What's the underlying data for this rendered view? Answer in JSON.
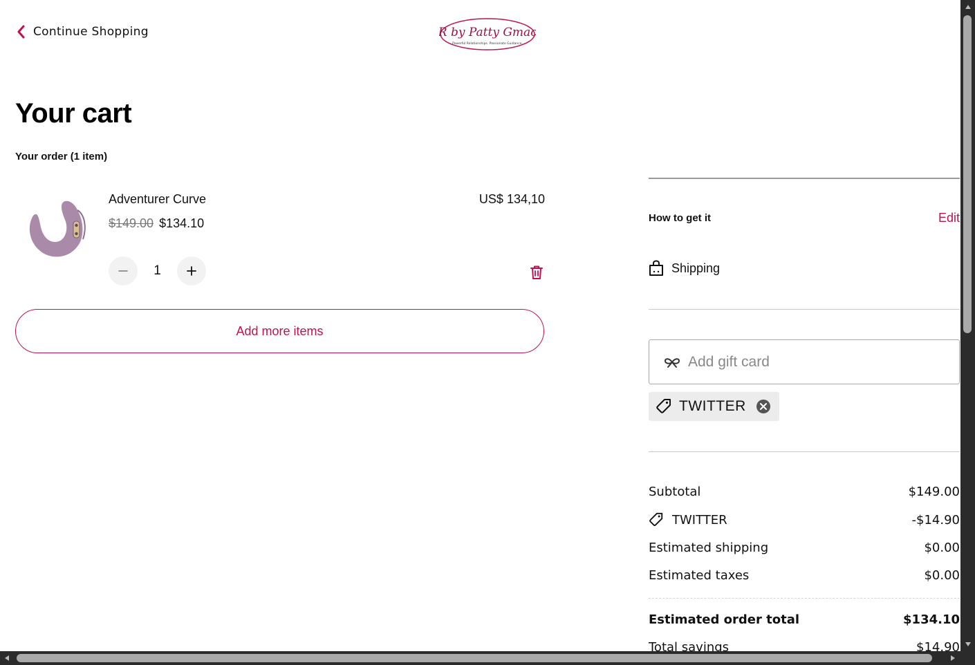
{
  "header": {
    "continue_label": "Continue Shopping",
    "logo_text": "PR by Patty Gmach",
    "logo_tagline": "Powerful Relationships. Passionate Guidance."
  },
  "cart": {
    "title": "Your cart",
    "order_count": "Your order (1 item)",
    "item": {
      "name": "Adventurer Curve",
      "original_price": "$149.00",
      "sale_price": "$134.10",
      "line_total": "US$ 134,10",
      "quantity": "1"
    },
    "add_more_label": "Add more items"
  },
  "fulfillment": {
    "heading": "How to get it",
    "edit_label": "Edit",
    "method": "Shipping"
  },
  "gift_card": {
    "placeholder": "Add gift card"
  },
  "promo": {
    "code": "TWITTER"
  },
  "summary": {
    "subtotal_label": "Subtotal",
    "subtotal_value": "$149.00",
    "discount_label": "TWITTER",
    "discount_value": "-$14.90",
    "shipping_label": "Estimated shipping",
    "shipping_value": "$0.00",
    "taxes_label": "Estimated taxes",
    "taxes_value": "$0.00",
    "total_label": "Estimated order total",
    "total_value": "$134.10",
    "savings_label": "Total savings",
    "savings_value": "$14.90"
  },
  "colors": {
    "accent": "#c0114f",
    "product": "#a98aa8"
  },
  "icons": {
    "back": "chevron-left-icon",
    "minus": "minus-icon",
    "plus": "plus-icon",
    "delete": "trash-icon",
    "shipping": "shopping-bag-icon",
    "gift": "gift-card-icon",
    "promo": "tag-icon",
    "remove": "close-circle-icon"
  }
}
